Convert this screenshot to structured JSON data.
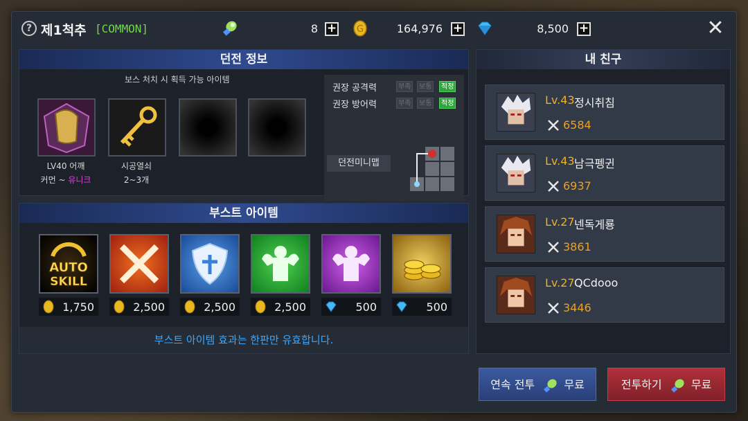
{
  "header": {
    "help_icon": "?",
    "title": "제1척추",
    "grade": "[COMMON]",
    "stamina": "8",
    "gold": "164,976",
    "gems": "8,500",
    "plus": "+",
    "close": "✕"
  },
  "dungeon_info": {
    "title": "던전 정보",
    "subtitle": "보스 처치 시 획득 가능 아이템",
    "items": [
      {
        "name": "LV40 어깨",
        "grade_from": "커먼 ~",
        "grade_to": "유니크"
      },
      {
        "name": "시공열쇠",
        "count": "2~3개"
      }
    ],
    "stats": [
      {
        "label": "권장 공격력",
        "tags": [
          "부족",
          "보통",
          "적정"
        ]
      },
      {
        "label": "권장 방어력",
        "tags": [
          "부족",
          "보통",
          "적정"
        ]
      }
    ],
    "minimap_label": "던전미니맵"
  },
  "boost": {
    "title": "부스트 아이템",
    "auto_skill_text": [
      "AUTO",
      "SKILL"
    ],
    "items": [
      {
        "icon": "auto-skill-icon",
        "currency": "gold",
        "cost": "1,750"
      },
      {
        "icon": "crossed-swords-icon",
        "currency": "gold",
        "cost": "2,500"
      },
      {
        "icon": "shield-icon",
        "currency": "gold",
        "cost": "2,500"
      },
      {
        "icon": "muscle-icon",
        "currency": "gold",
        "cost": "2,500"
      },
      {
        "icon": "muscle-purple-icon",
        "currency": "gem",
        "cost": "500"
      },
      {
        "icon": "gold-coins-icon",
        "currency": "gem",
        "cost": "500"
      }
    ],
    "note": "부스트 아이템 효과는 한판만 유효합니다."
  },
  "friends": {
    "title": "내 친구",
    "list": [
      {
        "level": "Lv.43",
        "name": "정시취침",
        "power": "6584",
        "avatar": "white"
      },
      {
        "level": "Lv.43",
        "name": "남극펭귄",
        "power": "6937",
        "avatar": "white"
      },
      {
        "level": "Lv.27",
        "name": "넨독게룡",
        "power": "3861",
        "avatar": "red"
      },
      {
        "level": "Lv.27",
        "name": "QCdooo",
        "power": "3446",
        "avatar": "red"
      }
    ]
  },
  "buttons": {
    "continuous_label": "연속 전투",
    "battle_label": "전투하기",
    "free": "무료"
  },
  "colors": {
    "grade": "#6fd84a",
    "unique": "#e040e0",
    "level": "#f0b020",
    "note": "#3aa8ff"
  }
}
